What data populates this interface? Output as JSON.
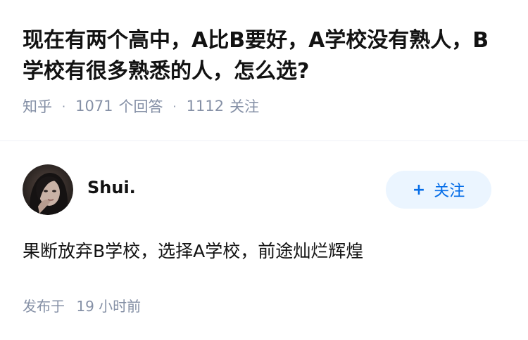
{
  "question": {
    "title": "现在有两个高中，A比B要好，A学校没有熟人，B学校有很多熟悉的人，怎么选?",
    "source": "知乎",
    "answer_count": "1071",
    "answer_count_label": "个回答",
    "follower_count": "1112",
    "follower_count_label": "关注",
    "separator": "·"
  },
  "answer": {
    "author": {
      "name": "Shui.",
      "avatar_icon": "avatar-photo"
    },
    "follow_button": {
      "icon": "plus-icon",
      "icon_glyph": "+",
      "label": "关注"
    },
    "content": "果断放弃B学校，选择A学校，前途灿烂辉煌",
    "time_label": "发布于",
    "time_value": "19 小时前"
  },
  "colors": {
    "text_primary": "#121212",
    "text_secondary": "#8590a6",
    "accent": "#056de8",
    "follow_bg": "#ebf5ff",
    "divider": "#f0f2f7"
  }
}
